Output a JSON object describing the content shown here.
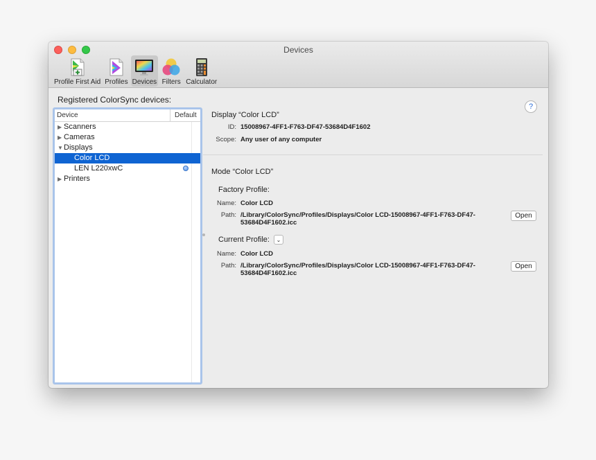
{
  "window": {
    "title": "Devices"
  },
  "toolbar": {
    "items": [
      {
        "label": "Profile First Aid",
        "icon": "profile-first-aid-icon"
      },
      {
        "label": "Profiles",
        "icon": "profiles-icon"
      },
      {
        "label": "Devices",
        "icon": "devices-icon",
        "active": true
      },
      {
        "label": "Filters",
        "icon": "filters-icon"
      },
      {
        "label": "Calculator",
        "icon": "calculator-icon"
      }
    ]
  },
  "list": {
    "heading": "Registered ColorSync devices:",
    "col_device": "Device",
    "col_default": "Default",
    "rows": [
      {
        "label": "Scanners",
        "expanded": false
      },
      {
        "label": "Cameras",
        "expanded": false
      },
      {
        "label": "Displays",
        "expanded": true
      },
      {
        "label": "Color LCD",
        "selected": true
      },
      {
        "label": "LEN L220xwC",
        "default": true
      },
      {
        "label": "Printers",
        "expanded": false
      }
    ],
    "triangle_closed": "▶",
    "triangle_open": "▼"
  },
  "help": {
    "label": "?"
  },
  "display": {
    "title": "Display “Color LCD”",
    "id_label": "ID:",
    "id_value": "15008967-4FF1-F763-DF47-53684D4F1602",
    "scope_label": "Scope:",
    "scope_value": "Any user of any computer"
  },
  "mode": {
    "title": "Mode “Color LCD”",
    "factory": {
      "title": "Factory Profile:",
      "name_label": "Name:",
      "name_value": "Color LCD",
      "path_label": "Path:",
      "path_value": "/Library/ColorSync/Profiles/Displays/Color LCD-15008967-4FF1-F763-DF47-53684D4F1602.icc",
      "open_label": "Open"
    },
    "current": {
      "title": "Current Profile:",
      "dropdown_glyph": "⌄",
      "name_label": "Name:",
      "name_value": "Color LCD",
      "path_label": "Path:",
      "path_value": "/Library/ColorSync/Profiles/Displays/Color LCD-15008967-4FF1-F763-DF47-53684D4F1602.icc",
      "open_label": "Open"
    }
  },
  "colors": {
    "selection": "#0f64d2",
    "focus_ring": "#a9c4ea",
    "close": "#fc605c",
    "minimize": "#fdbc40",
    "zoom": "#34c84a"
  }
}
